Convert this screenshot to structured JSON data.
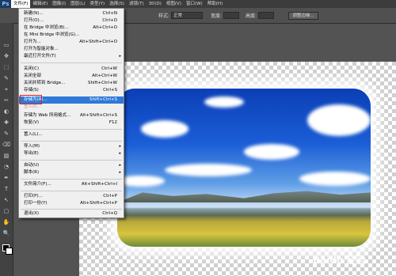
{
  "app": {
    "logo": "Ps"
  },
  "menubar": {
    "items": [
      {
        "label": "文件(F)",
        "active": true
      },
      {
        "label": "编辑(E)"
      },
      {
        "label": "图像(I)"
      },
      {
        "label": "图层(L)"
      },
      {
        "label": "类型(Y)"
      },
      {
        "label": "选择(S)"
      },
      {
        "label": "滤镜(T)"
      },
      {
        "label": "3D(D)"
      },
      {
        "label": "视图(V)"
      },
      {
        "label": "窗口(W)"
      },
      {
        "label": "帮助(H)"
      }
    ]
  },
  "options": {
    "style_label": "样式:",
    "style_value": "正常",
    "width_label": "宽度:",
    "height_label": "高度:",
    "refine_button": "调整边缘..."
  },
  "file_menu": {
    "items": [
      {
        "label": "新建(N)...",
        "shortcut": "Ctrl+N"
      },
      {
        "label": "打开(O)...",
        "shortcut": "Ctrl+O"
      },
      {
        "label": "在 Bridge 中浏览(B)...",
        "shortcut": "Alt+Ctrl+O"
      },
      {
        "label": "在 Mini Bridge 中浏览(G)...",
        "shortcut": ""
      },
      {
        "label": "打开为...",
        "shortcut": "Alt+Shift+Ctrl+O"
      },
      {
        "label": "打开为智能对象...",
        "shortcut": ""
      },
      {
        "label": "最近打开文件(T)",
        "shortcut": "",
        "submenu": true
      },
      {
        "label": "关闭(C)",
        "shortcut": "Ctrl+W"
      },
      {
        "label": "关闭全部",
        "shortcut": "Alt+Ctrl+W"
      },
      {
        "label": "关闭并转到 Bridge...",
        "shortcut": "Shift+Ctrl+W"
      },
      {
        "label": "存储(S)",
        "shortcut": "Ctrl+S"
      },
      {
        "label": "存储为(A)...",
        "shortcut": "Shift+Ctrl+S",
        "highlighted": true
      },
      {
        "label": "签入(I)...",
        "shortcut": "",
        "disabled": true
      },
      {
        "label": "存储为 Web 所用格式...",
        "shortcut": "Alt+Shift+Ctrl+S"
      },
      {
        "label": "恢复(V)",
        "shortcut": "F12"
      },
      {
        "label": "置入(L)...",
        "shortcut": ""
      },
      {
        "label": "导入(M)",
        "shortcut": "",
        "submenu": true
      },
      {
        "label": "导出(E)",
        "shortcut": "",
        "submenu": true
      },
      {
        "label": "自动(U)",
        "shortcut": "",
        "submenu": true
      },
      {
        "label": "脚本(R)",
        "shortcut": "",
        "submenu": true
      },
      {
        "label": "文件简介(F)...",
        "shortcut": "Alt+Shift+Ctrl+I"
      },
      {
        "label": "打印(P)...",
        "shortcut": "Ctrl+P"
      },
      {
        "label": "打印一份(Y)",
        "shortcut": "Alt+Shift+Ctrl+P"
      },
      {
        "label": "退出(X)",
        "shortcut": "Ctrl+Q"
      }
    ],
    "submenu_arrow": "▸"
  },
  "watermark": "Baidu 经验",
  "tools": [
    "▭",
    "✥",
    "⬚",
    "✎",
    "⌖",
    "✂",
    "◐",
    "✚",
    "✎",
    "⌫",
    "▨",
    "◔",
    "✒",
    "T",
    "↖",
    "▢",
    "✋",
    "🔍"
  ]
}
